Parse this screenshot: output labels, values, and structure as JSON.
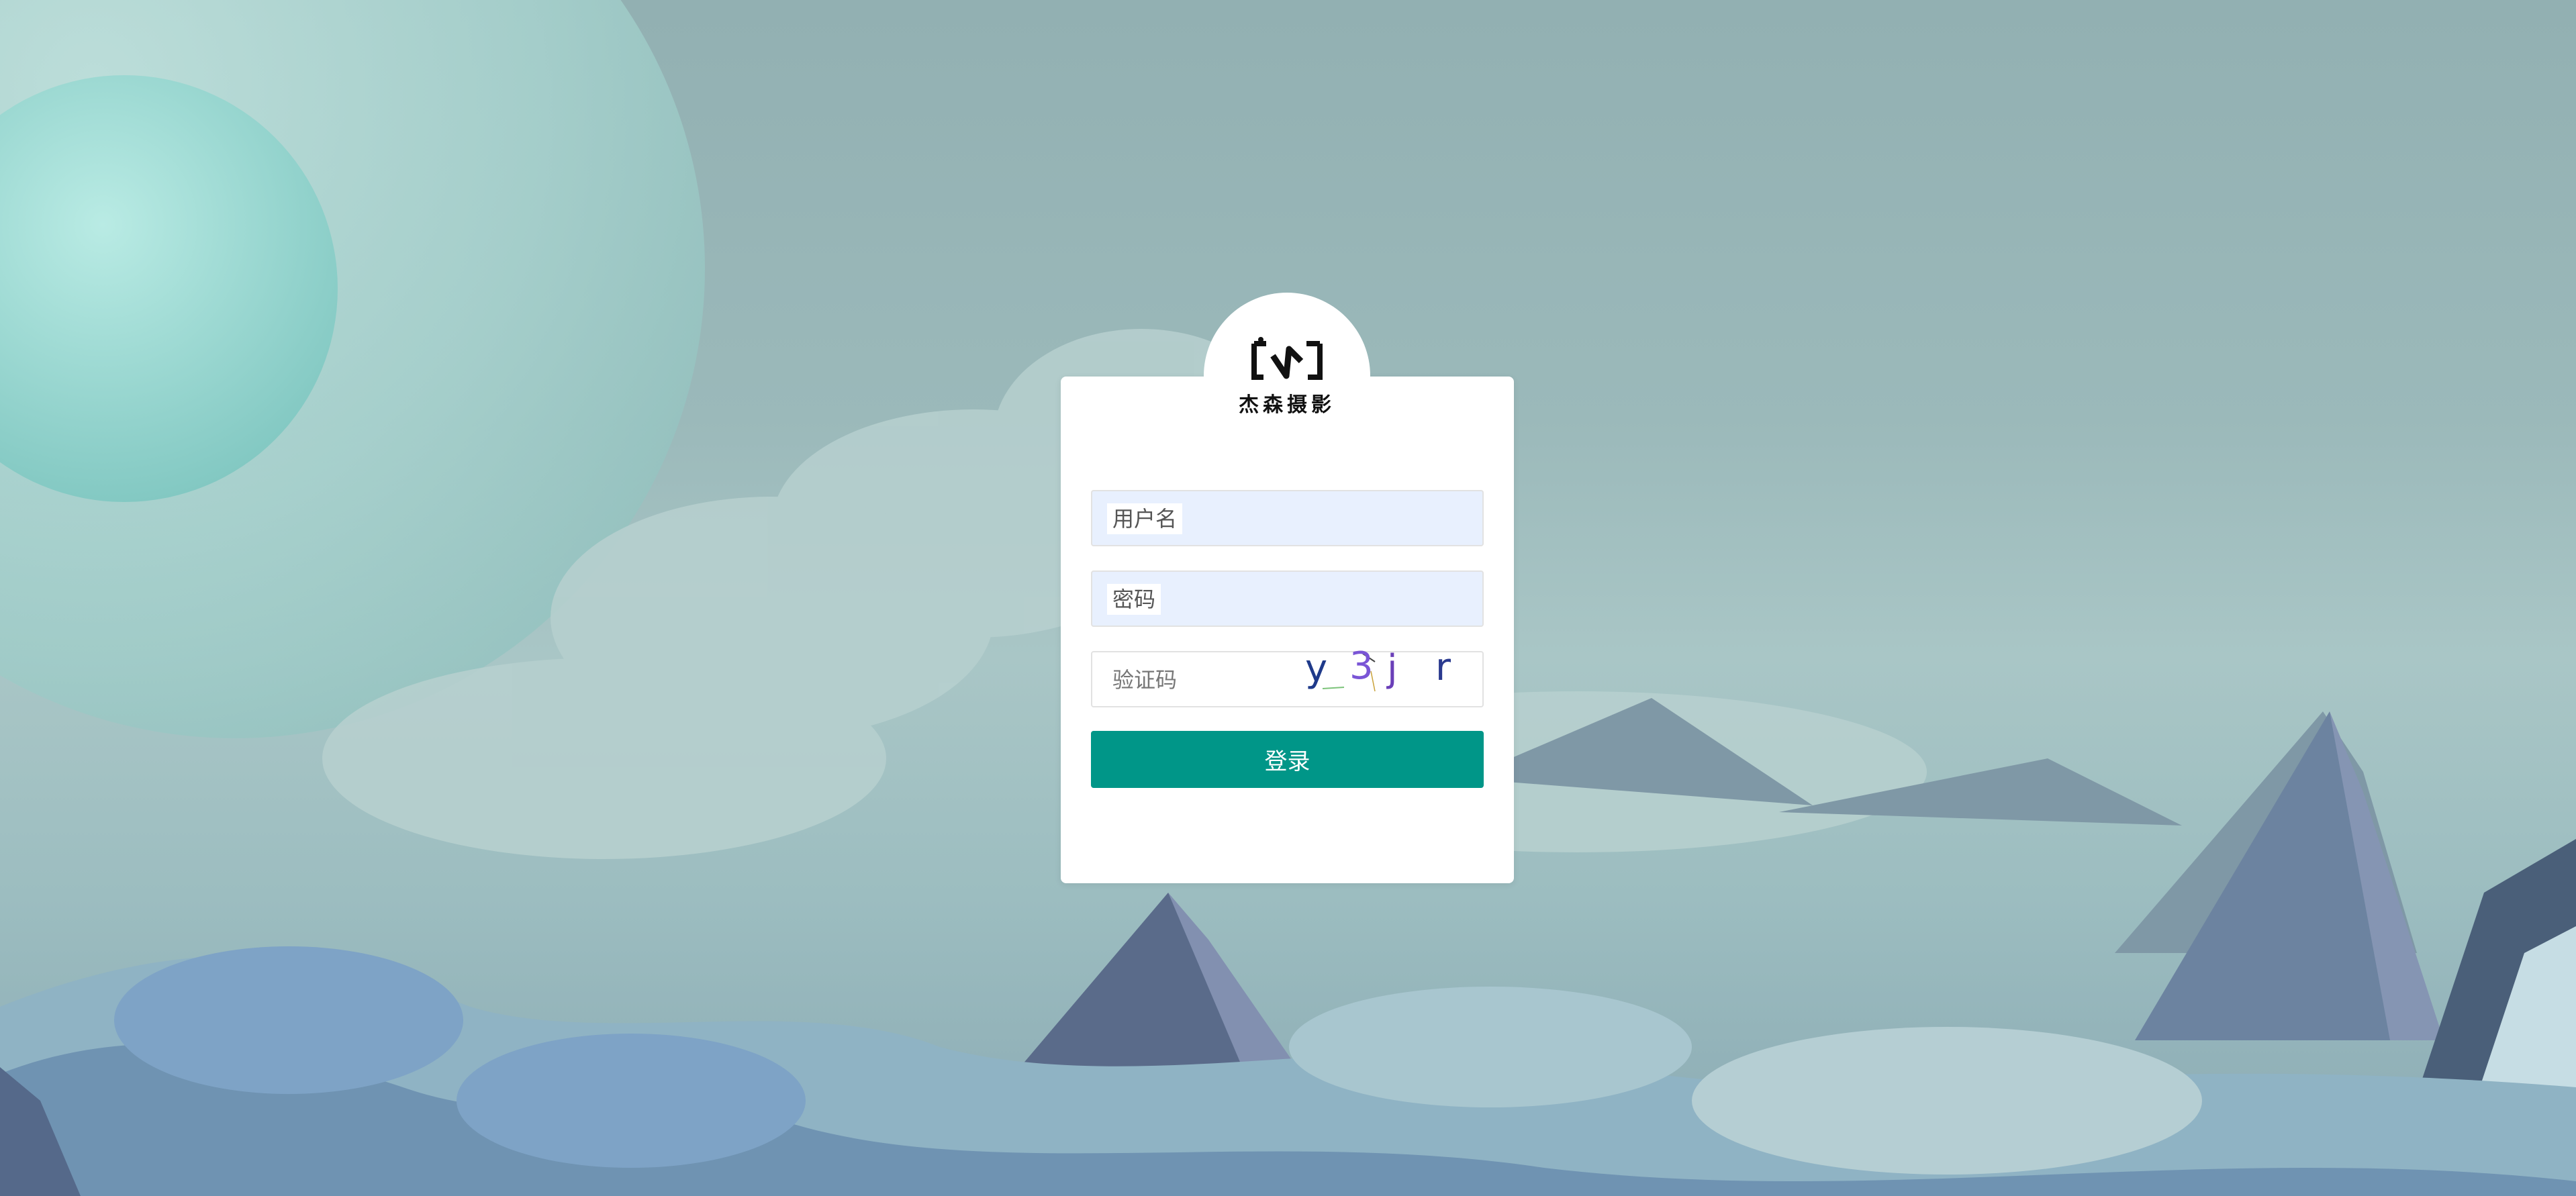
{
  "brand": {
    "logo_text": "杰森摄影",
    "logo_icon": "camera-bracket-logo"
  },
  "login_form": {
    "username_placeholder": "用户名",
    "password_placeholder": "密码",
    "captcha_placeholder": "验证码",
    "captcha_chars": [
      "y",
      "3",
      "j",
      "r"
    ],
    "submit_label": "登录"
  },
  "colors": {
    "primary": "#009688",
    "input_autofill_bg": "#e8f0fe",
    "card_bg": "#ffffff",
    "captcha_char_colors": [
      "#1f3a8a",
      "#7a55d6",
      "#6a3fb8",
      "#2a3a8f"
    ]
  }
}
